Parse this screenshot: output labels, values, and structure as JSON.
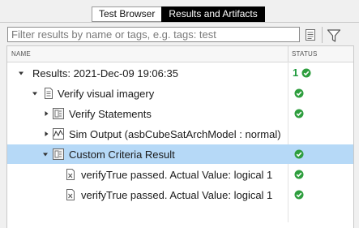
{
  "tabs": {
    "browser_label": "Test Browser",
    "results_label": "Results and Artifacts"
  },
  "filter": {
    "placeholder": "Filter results by name or tags, e.g. tags: test"
  },
  "columns": {
    "name": "NAME",
    "status": "STATUS"
  },
  "results": {
    "label": "Results: 2021-Dec-09 19:06:35",
    "passed_count": "1"
  },
  "rows": [
    {
      "label": "Verify visual imagery",
      "status": "passed"
    },
    {
      "label": "Verify Statements",
      "status": "passed"
    },
    {
      "label": "Sim Output (asbCubeSatArchModel : normal)",
      "status": ""
    },
    {
      "label": "Custom Criteria Result",
      "status": "passed",
      "selected": true
    },
    {
      "label": "verifyTrue passed. Actual Value: logical 1",
      "status": "passed"
    },
    {
      "label": "verifyTrue passed. Actual Value: logical 1",
      "status": "passed"
    }
  ],
  "colors": {
    "selected_row": "#b6d9f7",
    "pass_green": "#2e9e3e",
    "active_tab": "#000000"
  },
  "icons": [
    "document-icon",
    "filter-funnel-icon",
    "chevron-down-icon",
    "chevron-right-icon",
    "test-file-icon",
    "test-suite-icon",
    "signal-plot-icon",
    "diagnostic-icon",
    "pass-check-icon"
  ]
}
